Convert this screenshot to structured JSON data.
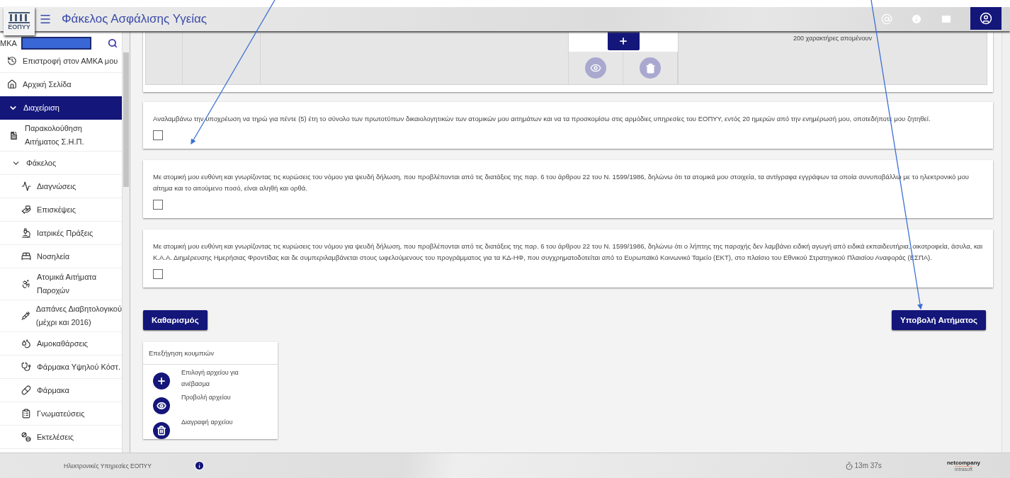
{
  "header": {
    "logo_text": "ΕΟΠΥΥ",
    "title": "Φάκελος Ασφάλισης Υγείας"
  },
  "sidebar": {
    "search": {
      "label": "ΜΚΑ"
    },
    "items": [
      {
        "label": "Επιστροφή στον ΑΜΚΑ μου",
        "selected": false
      },
      {
        "label": "Αρχική Σελίδα",
        "selected": false
      },
      {
        "label": "Διαχείριση",
        "selected": true,
        "expanded": true,
        "children": [
          {
            "lines": [
              "Παρακολούθηση",
              "Αιτήματος Σ.Η.Π."
            ],
            "selected": false
          },
          {
            "label": "Φάκελος",
            "selected": false,
            "expanded": true,
            "children": [
              {
                "label": "Διαγνώσεις",
                "selected": false
              },
              {
                "label": "Επισκέψεις",
                "selected": false
              },
              {
                "label": "Ιατρικές Πράξεις",
                "selected": false
              },
              {
                "label": "Νοσηλεία",
                "selected": false
              },
              {
                "lines": [
                  "Ατομικά Αιτήματα",
                  "Παροχών"
                ],
                "selected": false
              },
              {
                "lines": [
                  "Δαπάνες Διαβητολογικού",
                  "(μέχρι και 2016)"
                ],
                "selected": false
              },
              {
                "label": "Αιμοκαθάρσεις",
                "selected": false
              },
              {
                "label": "Φάρμακα Υψηλού Κόστ.",
                "selected": false
              },
              {
                "label": "Φάρμακα",
                "selected": false
              },
              {
                "label": "Γνωματεύσεις",
                "selected": false
              },
              {
                "label": "Εκτελέσεις",
                "selected": false
              }
            ]
          }
        ]
      }
    ]
  },
  "attachment_row": {
    "remaining": "200 χαρακτήρες απομένουν"
  },
  "declarations": [
    {
      "text": "Αναλαμβάνω την υποχρέωση να τηρώ για πέντε (5) έτη το σύνολο των πρωτοτύπων δικαιολογητικών των ατομικών μου αιτημάτων και να τα προσκομίσω στις αρμόδιες υπηρεσίες του ΕΟΠΥΥ, εντός 20 ημερών από την ενημέρωσή μου, οποτεδήποτε μου ζητηθεί.",
      "checked": false
    },
    {
      "text": "Με ατομική μου ευθύνη και γνωρίζοντας τις κυρώσεις του νόμου για ψευδή δήλωση, που προβλέπονται από τις διατάξεις της παρ. 6 του άρθρου 22 του Ν. 1599/1986, δηλώνω ότι τα ατομικά μου στοιχεία, τα αντίγραφα εγγράφων τα οποία συνυποβάλλω με το ηλεκτρονικό μου αίτημα και το αιτούμενο ποσό, είναι αληθή και ορθά.",
      "checked": false
    },
    {
      "text": "Με ατομική μου ευθύνη και γνωρίζοντας τις κυρώσεις του νόμου για ψευδή δήλωση, που προβλέπονται από τις διατάξεις της παρ. 6 του άρθρου 22 του Ν. 1599/1986, δηλώνω ότι ο λήπτης της παροχής δεν λαμβάνει ειδική αγωγή από ειδικά εκπαιδευτήρια, οικοτροφεία, άσυλα, και Κ.Α.Α. Διημέρευσης Ημερήσιας Φροντίδας και δε συμπεριλαμβάνεται στους ωφελούμενους του προγράμματος για τα ΚΔ-ΗΦ, που συγχρηματοδοτείται από το Ευρωπαϊκό Κοινωνικό Ταμείο (ΕΚΤ), στο πλαίσιο του Εθνικού Στρατηγικού Πλαισίου Αναφοράς (ΕΣΠΑ).",
      "checked": false
    }
  ],
  "buttons": [
    {
      "label": "Καθαρισμός"
    },
    {
      "label": "Υποβολή Αιτήματος"
    }
  ],
  "legend": {
    "title": "Επεξήγηση κουμπιών",
    "items": [
      {
        "label": "Επιλογή αρχείου για ανέβασμα"
      },
      {
        "label": "Προβολή αρχείου"
      },
      {
        "label": "Διαγραφή αρχείου"
      }
    ]
  },
  "footer": {
    "text": "Ηλεκτρονικές Υπηρεσίες ΕΟΠΥΥ",
    "timer": "13m 37s",
    "brand": "netcompany",
    "brand_sub": "intrasoft"
  }
}
